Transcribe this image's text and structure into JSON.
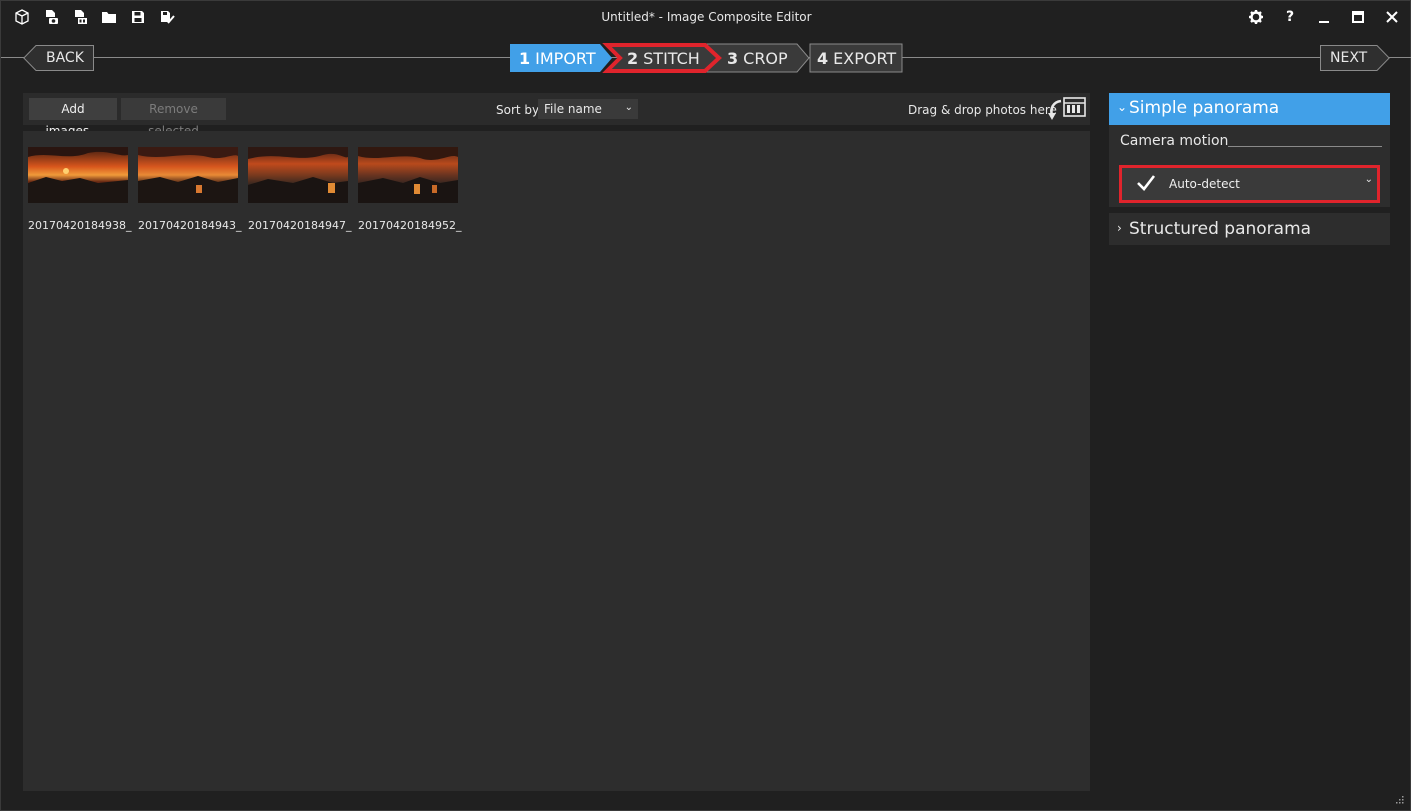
{
  "window": {
    "title": "Untitled* - Image Composite Editor",
    "toolbar_icons": [
      "new-project-icon",
      "new-panorama-from-video-icon",
      "new-panorama-from-images-icon",
      "open-folder-icon",
      "save-icon",
      "save-as-icon"
    ],
    "right_icons": [
      "settings-gear-icon",
      "help-icon",
      "minimize-icon",
      "maximize-icon",
      "close-icon"
    ],
    "help_glyph": "?"
  },
  "wizard": {
    "back_label": "BACK",
    "next_label": "NEXT",
    "steps": [
      {
        "num": "1",
        "label": "IMPORT",
        "state": "active"
      },
      {
        "num": "2",
        "label": "STITCH",
        "state": "highlighted"
      },
      {
        "num": "3",
        "label": "CROP",
        "state": "normal"
      },
      {
        "num": "4",
        "label": "EXPORT",
        "state": "normal"
      }
    ],
    "active_color": "#41a0e8",
    "highlight_color": "#e0242c"
  },
  "import_toolbar": {
    "add_label": "Add images...",
    "remove_label": "Remove selected",
    "sort_label": "Sort by",
    "sort_value": "File name",
    "drop_hint": "Drag & drop photos here"
  },
  "images": [
    {
      "caption": "20170420184938_..."
    },
    {
      "caption": "20170420184943_..."
    },
    {
      "caption": "20170420184947_..."
    },
    {
      "caption": "20170420184952_..."
    }
  ],
  "panel": {
    "simple_title": "Simple panorama",
    "camera_motion_label": "Camera motion",
    "camera_motion_value": "Auto-detect",
    "structured_title": "Structured panorama"
  }
}
